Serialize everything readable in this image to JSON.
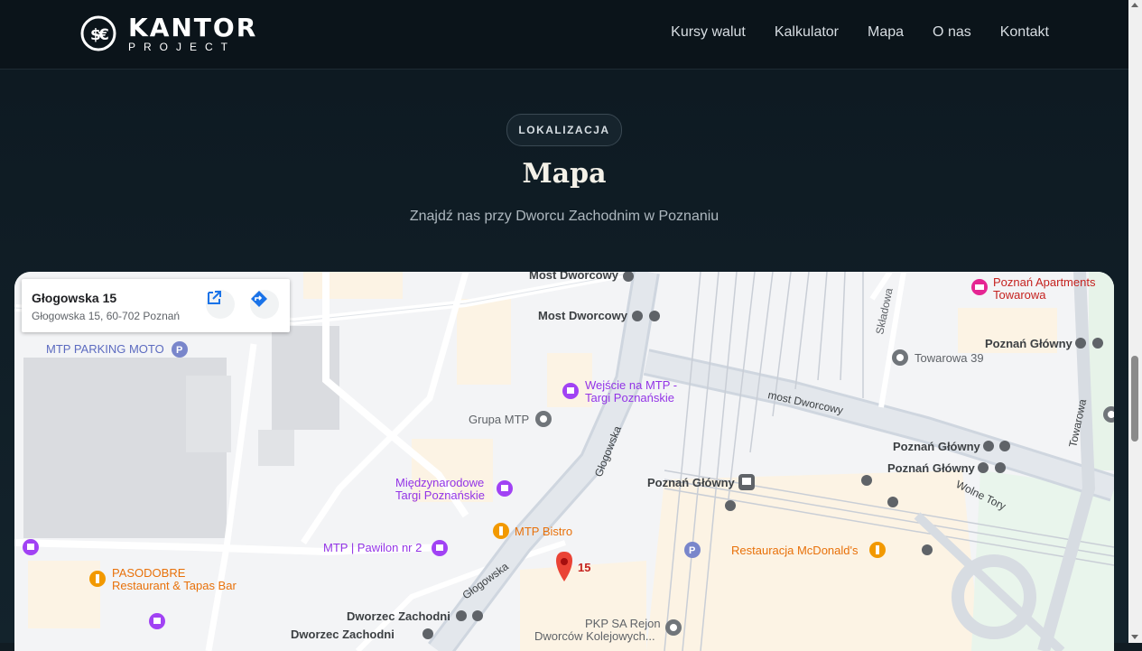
{
  "brand": {
    "name": "KANTOR",
    "tagline": "PROJECT"
  },
  "nav": {
    "items": [
      "Kursy walut",
      "Kalkulator",
      "Mapa",
      "O nas",
      "Kontakt"
    ]
  },
  "section": {
    "badge": "LOKALIZACJA",
    "title": "Mapa",
    "subtitle": "Znajdź nas przy Dworcu Zachodnim w Poznaniu"
  },
  "map": {
    "place_title": "Głogowska 15",
    "place_address": "Głogowska 15, 60-702 Poznań",
    "labels": {
      "most_dworcowy_1": "Most Dworcowy",
      "most_dworcowy_2": "Most Dworcowy",
      "poznan_apartments": "Poznań Apartments",
      "towarowa_hotel": "Towarowa",
      "skladowa": "Składowa",
      "poznan_glowny_ne": "Poznań Główny",
      "towarowa_39": "Towarowa 39",
      "mtp_parking": "MTP PARKING MOTO",
      "wejscie_mtp_1": "Wejście na MTP -",
      "wejscie_mtp_2": "Targi Poznańskie",
      "most_dworcowy_road": "most Dworcowy",
      "towarowa_road": "Towarowa",
      "grupa_mtp": "Grupa MTP",
      "poznan_glowny_2": "Poznań Główny",
      "poznan_glowny_3": "Poznań Główny",
      "glogowska_road_1": "Głogowska",
      "miedzynarodowe_1": "Międzynarodowe",
      "miedzynarodowe_2": "Targi Poznańskie",
      "poznan_glowny_station": "Poznań Główny",
      "wolne_tory": "Wolne Tory",
      "mtp_bistro": "MTP Bistro",
      "mtp_pawilon": "MTP | Pawilon nr 2",
      "mcdonalds": "Restauracja McDonald's",
      "pin_number": "15",
      "pasodobre_1": "PASODOBRE",
      "pasodobre_2": "Restaurant & Tapas Bar",
      "glogowska_road_2": "Głogowska",
      "dworzec_zachodni_1": "Dworzec Zachodni",
      "dworzec_zachodni_2": "Dworzec Zachodni",
      "pkp_rejon_1": "PKP SA Rejon",
      "pkp_rejon_2": "Dworców Kolejowych..."
    }
  },
  "colors": {
    "accent_pin": "#ea4335",
    "poi_purple": "#a142f4",
    "poi_orange": "#f29900",
    "poi_gray": "#70757a",
    "poi_blue": "#7986cb",
    "directions_blue": "#1a73e8"
  }
}
